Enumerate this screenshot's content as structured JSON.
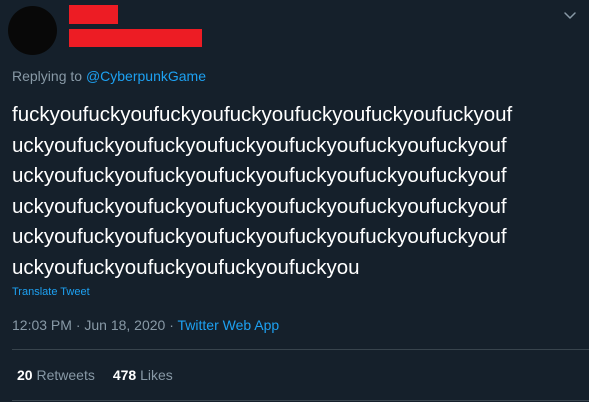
{
  "reply": {
    "prefix": "Replying to ",
    "mention": "@CyberpunkGame"
  },
  "tweet": {
    "lines": [
      "fuckyoufuckyoufuckyoufuckyoufuckyoufuckyoufuckyouf",
      "uckyoufuckyoufuckyoufuckyoufuckyoufuckyoufuckyouf",
      "uckyoufuckyoufuckyoufuckyoufuckyoufuckyoufuckyouf",
      "uckyoufuckyoufuckyoufuckyoufuckyoufuckyoufuckyouf",
      "uckyoufuckyoufuckyoufuckyoufuckyoufuckyoufuckyouf",
      "uckyoufuckyoufuckyoufuckyoufuckyou"
    ],
    "translate_label": "Translate Tweet"
  },
  "meta": {
    "time_date": "12:03 PM · Jun 18, 2020 · ",
    "app": "Twitter Web App"
  },
  "stats": {
    "retweets_count": "20",
    "retweets_label": "Retweets",
    "likes_count": "478",
    "likes_label": "Likes"
  },
  "icons": {
    "menu": "chevron-down-icon"
  },
  "colors": {
    "background": "#15202b",
    "accent": "#1da1f2",
    "muted": "#8899a6",
    "redaction": "#ed1c24"
  }
}
